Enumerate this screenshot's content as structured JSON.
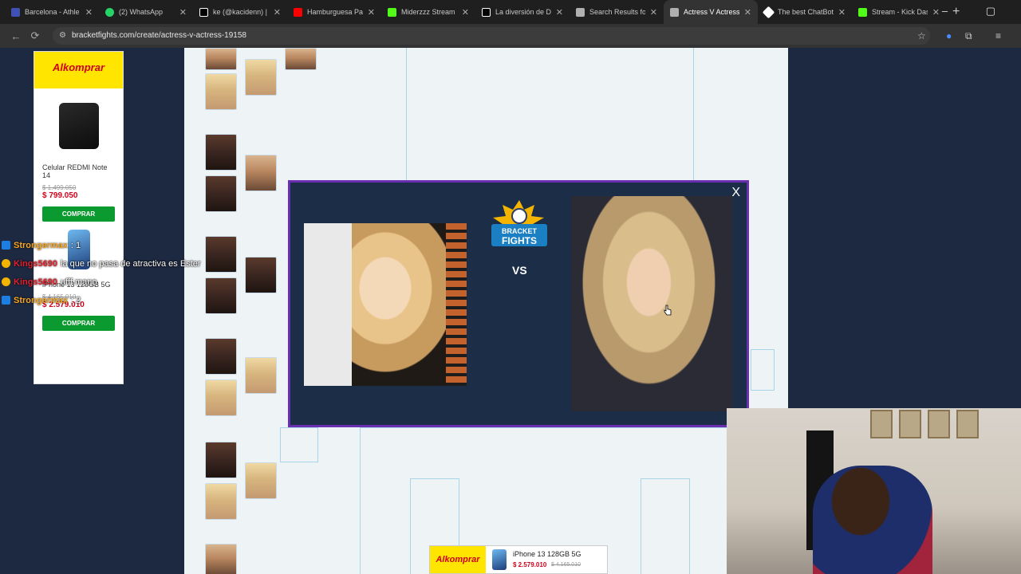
{
  "browser": {
    "tabs": [
      {
        "title": "Barcelona - Athle",
        "color": "#3f51b5"
      },
      {
        "title": "(2) WhatsApp",
        "color": "#25d366"
      },
      {
        "title": "ke (@kacidenn) |",
        "color": "#ffffff"
      },
      {
        "title": "Hamburguesa Pa",
        "color": "#ff0000"
      },
      {
        "title": "Miderzzz Stream",
        "color": "#53fc18"
      },
      {
        "title": "La diversión de D",
        "color": "#ffffff"
      },
      {
        "title": "Search Results fo",
        "color": "#b0b0b0"
      },
      {
        "title": "Actress V Actress",
        "color": "#b0b0b0"
      },
      {
        "title": "The best ChatBot",
        "color": "#ffffff"
      },
      {
        "title": "Stream - Kick Das",
        "color": "#53fc18"
      }
    ],
    "active_tab_index": 7,
    "url": "bracketfights.com/create/actress-v-actress-19158",
    "new_tab_symbol": "+",
    "close_symbol": "✕"
  },
  "ad": {
    "brand": "Alkomprar",
    "product1": {
      "name": "Celular REDMI Note 14",
      "old_price": "$ 1.499.050",
      "price": "$ 799.050",
      "button": "COMPRAR"
    },
    "product2": {
      "name": "iPhone 13 128GB 5G",
      "old_price": "$ 4.165.010",
      "price": "$ 2.579.010",
      "button": "COMPRAR"
    }
  },
  "chat": [
    {
      "user": "Strongermax",
      "message": ": 1",
      "user_color": "#f5a623",
      "icon": "stream-badge-icon"
    },
    {
      "user": "Kings5690",
      "message": "la que no pasa de atractiva es Ester",
      "user_color": "#e0202b",
      "icon": "gift-badge-icon"
    },
    {
      "user": "Kings5690",
      "message": "ufff mano",
      "user_color": "#e0202b",
      "icon": "gift-badge-icon"
    },
    {
      "user": "Strongermax",
      "message": ": 2",
      "user_color": "#f5a623",
      "icon": "stream-badge-icon"
    }
  ],
  "modal": {
    "close_label": "X",
    "logo_text_top": "BRACKET",
    "logo_text_bottom": "FIGHTS",
    "vs_label": "VS"
  },
  "bottom_ad": {
    "brand": "Alkomprar",
    "product_name": "iPhone 13 128GB 5G",
    "price": "$ 2.579.010",
    "old_price": "$ 4.165.010"
  }
}
